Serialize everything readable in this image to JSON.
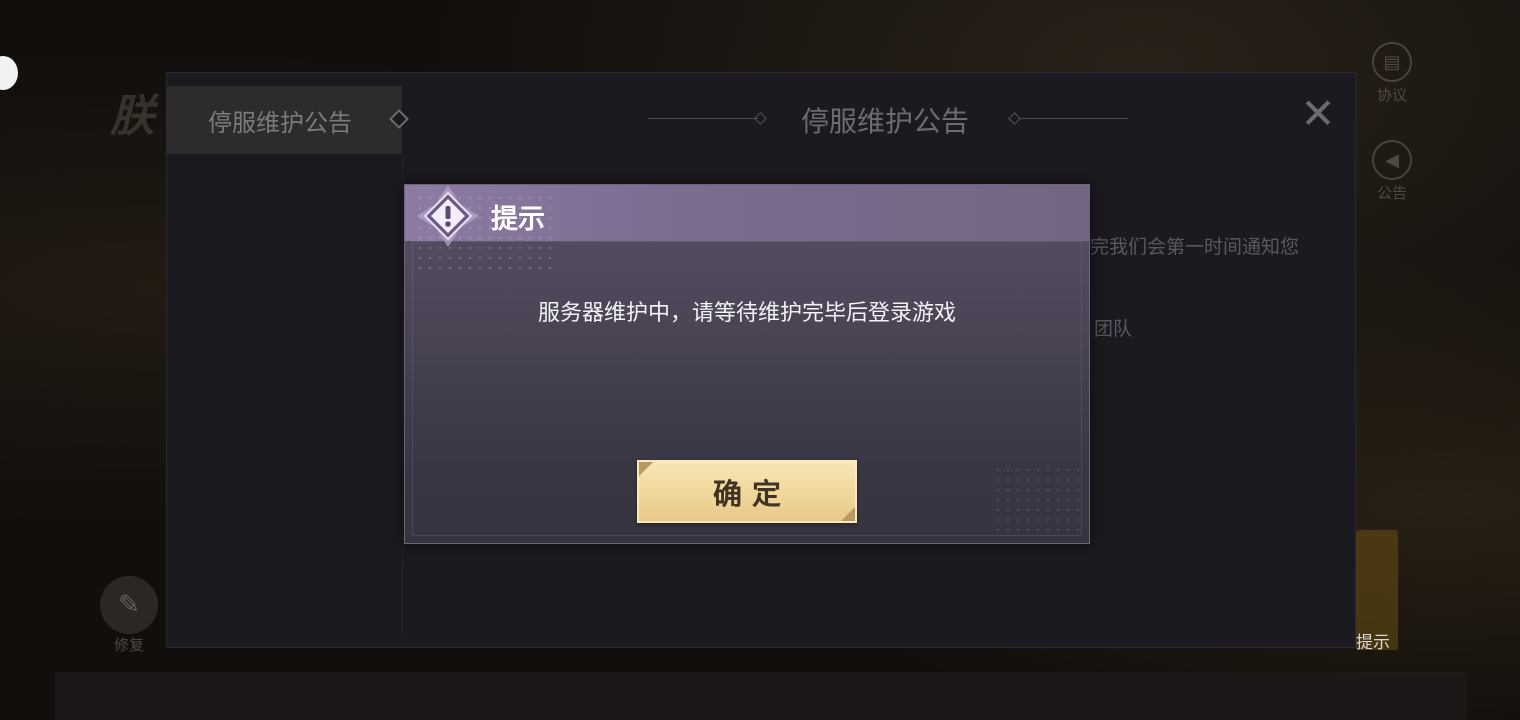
{
  "background": {
    "side_buttons": [
      {
        "icon": "document-icon",
        "label": "协议"
      },
      {
        "icon": "megaphone-icon",
        "label": "公告"
      }
    ],
    "repair": {
      "icon": "wrench-icon",
      "label": "修复"
    },
    "right_label": "提示"
  },
  "announcement": {
    "tab_label": "停服维护公告",
    "title": "停服维护公告",
    "close_icon": "close-icon",
    "text_line1": "完我们会第一时间通知您",
    "text_line2": "团队"
  },
  "dialog": {
    "icon": "warning-icon",
    "title": "提示",
    "message": "服务器维护中，请等待维护完毕后登录游戏",
    "confirm_label": "确定"
  },
  "colors": {
    "dialog_header": "#8d7ba3",
    "confirm_button": "#f0d79b",
    "confirm_text": "#3f3422"
  }
}
